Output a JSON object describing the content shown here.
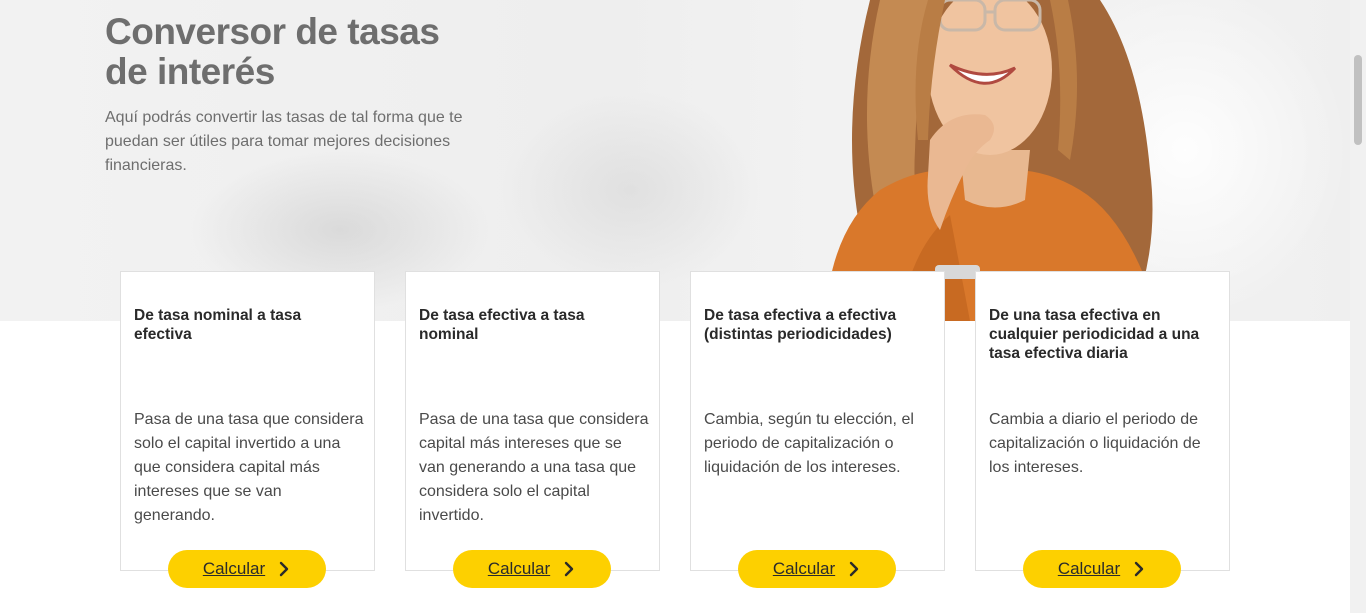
{
  "hero": {
    "title": "Conversor de tasas de interés",
    "description": "Aquí podrás convertir las tasas de tal forma que te puedan ser útiles para tomar mejores decisiones financieras."
  },
  "cards": [
    {
      "title": "De tasa nominal a tasa efectiva",
      "description": "Pasa de una tasa que considera solo el capital invertido a una que considera capital más intereses que se van generando.",
      "button_label": "Calcular"
    },
    {
      "title": "De tasa efectiva a tasa nominal",
      "description": "Pasa de una tasa que considera capital más intereses que se van generando a una tasa que considera solo el capital invertido.",
      "button_label": "Calcular"
    },
    {
      "title": "De tasa efectiva a efectiva (distintas periodicidades)",
      "description": "Cambia, según tu elección, el periodo de capitalización o liquidación de los intereses.",
      "button_label": "Calcular"
    },
    {
      "title": "De una tasa efectiva en cualquier periodicidad a una tasa efectiva diaria",
      "description": "Cambia a diario el periodo de capitalización o liquidación de los intereses.",
      "button_label": "Calcular"
    }
  ],
  "colors": {
    "accent": "#fdd000",
    "title_gray": "#6e6e6e",
    "text_dark": "#2a2a2a",
    "shirt_orange": "#d9782b"
  },
  "icons": {
    "button_icon": "chevron-right-icon"
  }
}
